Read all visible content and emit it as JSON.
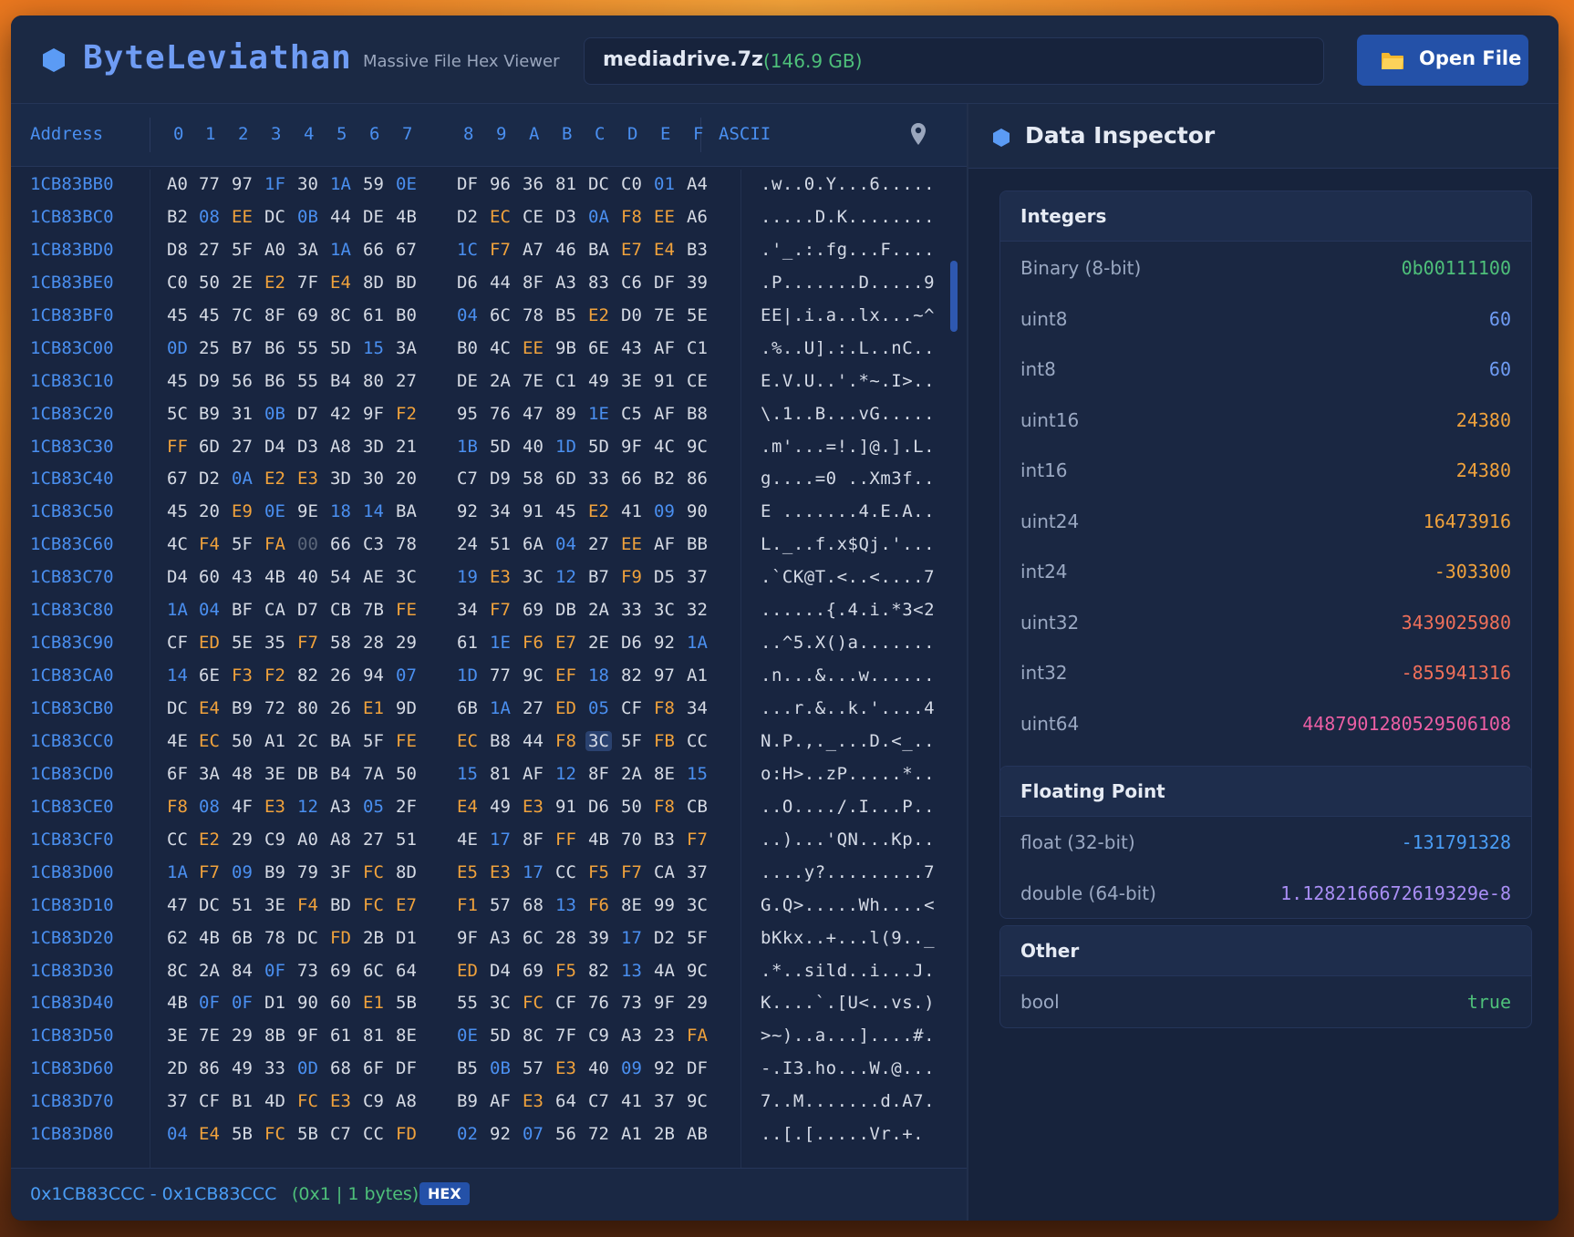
{
  "app": {
    "title": "ByteLeviathan",
    "subtitle": "Massive File Hex Viewer",
    "file_name": "mediadrive.7z",
    "file_size": "(146.9 GB)",
    "open_button": "Open File"
  },
  "hex_view": {
    "address_header": "Address",
    "ascii_header": "ASCII",
    "columns": [
      "0",
      "1",
      "2",
      "3",
      "4",
      "5",
      "6",
      "7",
      "8",
      "9",
      "A",
      "B",
      "C",
      "D",
      "E",
      "F"
    ],
    "rows": [
      {
        "addr": "1CB83BB0",
        "bytes": [
          "A0",
          "77",
          "97",
          "1F",
          "30",
          "1A",
          "59",
          "0E",
          "DF",
          "96",
          "36",
          "81",
          "DC",
          "C0",
          "01",
          "A4"
        ],
        "ascii": ".w..0.Y...6....."
      },
      {
        "addr": "1CB83BC0",
        "bytes": [
          "B2",
          "08",
          "EE",
          "DC",
          "0B",
          "44",
          "DE",
          "4B",
          "D2",
          "EC",
          "CE",
          "D3",
          "0A",
          "F8",
          "EE",
          "A6"
        ],
        "ascii": ".....D.K........"
      },
      {
        "addr": "1CB83BD0",
        "bytes": [
          "D8",
          "27",
          "5F",
          "A0",
          "3A",
          "1A",
          "66",
          "67",
          "1C",
          "F7",
          "A7",
          "46",
          "BA",
          "E7",
          "E4",
          "B3"
        ],
        "ascii": ".'_.:.fg...F...."
      },
      {
        "addr": "1CB83BE0",
        "bytes": [
          "C0",
          "50",
          "2E",
          "E2",
          "7F",
          "E4",
          "8D",
          "BD",
          "D6",
          "44",
          "8F",
          "A3",
          "83",
          "C6",
          "DF",
          "39"
        ],
        "ascii": ".P.......D.....9"
      },
      {
        "addr": "1CB83BF0",
        "bytes": [
          "45",
          "45",
          "7C",
          "8F",
          "69",
          "8C",
          "61",
          "B0",
          "04",
          "6C",
          "78",
          "B5",
          "E2",
          "D0",
          "7E",
          "5E"
        ],
        "ascii": "EE|.i.a..lx...~^"
      },
      {
        "addr": "1CB83C00",
        "bytes": [
          "0D",
          "25",
          "B7",
          "B6",
          "55",
          "5D",
          "15",
          "3A",
          "B0",
          "4C",
          "EE",
          "9B",
          "6E",
          "43",
          "AF",
          "C1"
        ],
        "ascii": ".%..U].:.L..nC.."
      },
      {
        "addr": "1CB83C10",
        "bytes": [
          "45",
          "D9",
          "56",
          "B6",
          "55",
          "B4",
          "80",
          "27",
          "DE",
          "2A",
          "7E",
          "C1",
          "49",
          "3E",
          "91",
          "CE"
        ],
        "ascii": "E.V.U..'.*~.I>.."
      },
      {
        "addr": "1CB83C20",
        "bytes": [
          "5C",
          "B9",
          "31",
          "0B",
          "D7",
          "42",
          "9F",
          "F2",
          "95",
          "76",
          "47",
          "89",
          "1E",
          "C5",
          "AF",
          "B8"
        ],
        "ascii": "\\.1..B...vG....."
      },
      {
        "addr": "1CB83C30",
        "bytes": [
          "FF",
          "6D",
          "27",
          "D4",
          "D3",
          "A8",
          "3D",
          "21",
          "1B",
          "5D",
          "40",
          "1D",
          "5D",
          "9F",
          "4C",
          "9C"
        ],
        "ascii": ".m'...=!.]@.].L."
      },
      {
        "addr": "1CB83C40",
        "bytes": [
          "67",
          "D2",
          "0A",
          "E2",
          "E3",
          "3D",
          "30",
          "20",
          "C7",
          "D9",
          "58",
          "6D",
          "33",
          "66",
          "B2",
          "86"
        ],
        "ascii": "g....=0 ..Xm3f.."
      },
      {
        "addr": "1CB83C50",
        "bytes": [
          "45",
          "20",
          "E9",
          "0E",
          "9E",
          "18",
          "14",
          "BA",
          "92",
          "34",
          "91",
          "45",
          "E2",
          "41",
          "09",
          "90"
        ],
        "ascii": "E .......4.E.A.."
      },
      {
        "addr": "1CB83C60",
        "bytes": [
          "4C",
          "F4",
          "5F",
          "FA",
          "00",
          "66",
          "C3",
          "78",
          "24",
          "51",
          "6A",
          "04",
          "27",
          "EE",
          "AF",
          "BB"
        ],
        "ascii": "L._..f.x$Qj.'..."
      },
      {
        "addr": "1CB83C70",
        "bytes": [
          "D4",
          "60",
          "43",
          "4B",
          "40",
          "54",
          "AE",
          "3C",
          "19",
          "E3",
          "3C",
          "12",
          "B7",
          "F9",
          "D5",
          "37"
        ],
        "ascii": ".`CK@T.<..<....7"
      },
      {
        "addr": "1CB83C80",
        "bytes": [
          "1A",
          "04",
          "BF",
          "CA",
          "D7",
          "CB",
          "7B",
          "FE",
          "34",
          "F7",
          "69",
          "DB",
          "2A",
          "33",
          "3C",
          "32"
        ],
        "ascii": "......{.4.i.*3<2"
      },
      {
        "addr": "1CB83C90",
        "bytes": [
          "CF",
          "ED",
          "5E",
          "35",
          "F7",
          "58",
          "28",
          "29",
          "61",
          "1E",
          "F6",
          "E7",
          "2E",
          "D6",
          "92",
          "1A"
        ],
        "ascii": "..^5.X()a......."
      },
      {
        "addr": "1CB83CA0",
        "bytes": [
          "14",
          "6E",
          "F3",
          "F2",
          "82",
          "26",
          "94",
          "07",
          "1D",
          "77",
          "9C",
          "EF",
          "18",
          "82",
          "97",
          "A1"
        ],
        "ascii": ".n...&...w......"
      },
      {
        "addr": "1CB83CB0",
        "bytes": [
          "DC",
          "E4",
          "B9",
          "72",
          "80",
          "26",
          "E1",
          "9D",
          "6B",
          "1A",
          "27",
          "ED",
          "05",
          "CF",
          "F8",
          "34"
        ],
        "ascii": "...r.&..k.'....4"
      },
      {
        "addr": "1CB83CC0",
        "bytes": [
          "4E",
          "EC",
          "50",
          "A1",
          "2C",
          "BA",
          "5F",
          "FE",
          "EC",
          "B8",
          "44",
          "F8",
          "3C",
          "5F",
          "FB",
          "CC"
        ],
        "ascii": "N.P.,._...D.<_.."
      },
      {
        "addr": "1CB83CD0",
        "bytes": [
          "6F",
          "3A",
          "48",
          "3E",
          "DB",
          "B4",
          "7A",
          "50",
          "15",
          "81",
          "AF",
          "12",
          "8F",
          "2A",
          "8E",
          "15"
        ],
        "ascii": "o:H>..zP.....*.."
      },
      {
        "addr": "1CB83CE0",
        "bytes": [
          "F8",
          "08",
          "4F",
          "E3",
          "12",
          "A3",
          "05",
          "2F",
          "E4",
          "49",
          "E3",
          "91",
          "D6",
          "50",
          "F8",
          "CB"
        ],
        "ascii": "..O..../.I...P.."
      },
      {
        "addr": "1CB83CF0",
        "bytes": [
          "CC",
          "E2",
          "29",
          "C9",
          "A0",
          "A8",
          "27",
          "51",
          "4E",
          "17",
          "8F",
          "FF",
          "4B",
          "70",
          "B3",
          "F7"
        ],
        "ascii": "..)...'QN...Kp.."
      },
      {
        "addr": "1CB83D00",
        "bytes": [
          "1A",
          "F7",
          "09",
          "B9",
          "79",
          "3F",
          "FC",
          "8D",
          "E5",
          "E3",
          "17",
          "CC",
          "F5",
          "F7",
          "CA",
          "37"
        ],
        "ascii": "....y?.........7"
      },
      {
        "addr": "1CB83D10",
        "bytes": [
          "47",
          "DC",
          "51",
          "3E",
          "F4",
          "BD",
          "FC",
          "E7",
          "F1",
          "57",
          "68",
          "13",
          "F6",
          "8E",
          "99",
          "3C"
        ],
        "ascii": "G.Q>.....Wh....<"
      },
      {
        "addr": "1CB83D20",
        "bytes": [
          "62",
          "4B",
          "6B",
          "78",
          "DC",
          "FD",
          "2B",
          "D1",
          "9F",
          "A3",
          "6C",
          "28",
          "39",
          "17",
          "D2",
          "5F"
        ],
        "ascii": "bKkx..+...l(9.._"
      },
      {
        "addr": "1CB83D30",
        "bytes": [
          "8C",
          "2A",
          "84",
          "0F",
          "73",
          "69",
          "6C",
          "64",
          "ED",
          "D4",
          "69",
          "F5",
          "82",
          "13",
          "4A",
          "9C"
        ],
        "ascii": ".*..sild..i...J."
      },
      {
        "addr": "1CB83D40",
        "bytes": [
          "4B",
          "0F",
          "0F",
          "D1",
          "90",
          "60",
          "E1",
          "5B",
          "55",
          "3C",
          "FC",
          "CF",
          "76",
          "73",
          "9F",
          "29"
        ],
        "ascii": "K....`.[U<..vs.)"
      },
      {
        "addr": "1CB83D50",
        "bytes": [
          "3E",
          "7E",
          "29",
          "8B",
          "9F",
          "61",
          "81",
          "8E",
          "0E",
          "5D",
          "8C",
          "7F",
          "C9",
          "A3",
          "23",
          "FA"
        ],
        "ascii": ">~)..a...]....#."
      },
      {
        "addr": "1CB83D60",
        "bytes": [
          "2D",
          "86",
          "49",
          "33",
          "0D",
          "68",
          "6F",
          "DF",
          "B5",
          "0B",
          "57",
          "E3",
          "40",
          "09",
          "92",
          "DF"
        ],
        "ascii": "-.I3.ho...W.@..."
      },
      {
        "addr": "1CB83D70",
        "bytes": [
          "37",
          "CF",
          "B1",
          "4D",
          "FC",
          "E3",
          "C9",
          "A8",
          "B9",
          "AF",
          "E3",
          "64",
          "C7",
          "41",
          "37",
          "9C"
        ],
        "ascii": "7..M.......d.A7."
      },
      {
        "addr": "1CB83D80",
        "bytes": [
          "04",
          "E4",
          "5B",
          "FC",
          "5B",
          "C7",
          "CC",
          "FD",
          "02",
          "92",
          "07",
          "56",
          "72",
          "A1",
          "2B",
          "AB"
        ],
        "ascii": "..[.[.....Vr.+."
      }
    ],
    "selected_byte": {
      "row": 17,
      "col": 12
    }
  },
  "status": {
    "range": "0x1CB83CCC - 0x1CB83CCC",
    "length": "(0x1 | 1 bytes)",
    "mode_badge": "HEX"
  },
  "inspector": {
    "title": "Data Inspector",
    "integers_title": "Integers",
    "integers": [
      {
        "label": "Binary (8-bit)",
        "value": "0b00111100",
        "color": "#4ec07a"
      },
      {
        "label": "uint8",
        "value": "60",
        "color": "#6f9cf4"
      },
      {
        "label": "int8",
        "value": "60",
        "color": "#6f9cf4"
      },
      {
        "label": "uint16",
        "value": "24380",
        "color": "#f0a23c"
      },
      {
        "label": "int16",
        "value": "24380",
        "color": "#f0a23c"
      },
      {
        "label": "uint24",
        "value": "16473916",
        "color": "#f0a23c"
      },
      {
        "label": "int24",
        "value": "-303300",
        "color": "#f0a23c"
      },
      {
        "label": "uint32",
        "value": "3439025980",
        "color": "#f0705a"
      },
      {
        "label": "int32",
        "value": "-855941316",
        "color": "#f0705a"
      },
      {
        "label": "uint64",
        "value": "4487901280529506108",
        "color": "#ec5fa4"
      },
      {
        "label": "int64",
        "value": "4487901280529506108",
        "color": "#ec5fa4"
      }
    ],
    "float_title": "Floating Point",
    "floats": [
      {
        "label": "float (32-bit)",
        "value": "-131791328",
        "color": "#4a9df5"
      },
      {
        "label": "double (64-bit)",
        "value": "1.1282166672619329e-8",
        "color": "#a98ef5"
      }
    ],
    "other_title": "Other",
    "other": [
      {
        "label": "bool",
        "value": "true",
        "color": "#4ec07a"
      }
    ]
  }
}
